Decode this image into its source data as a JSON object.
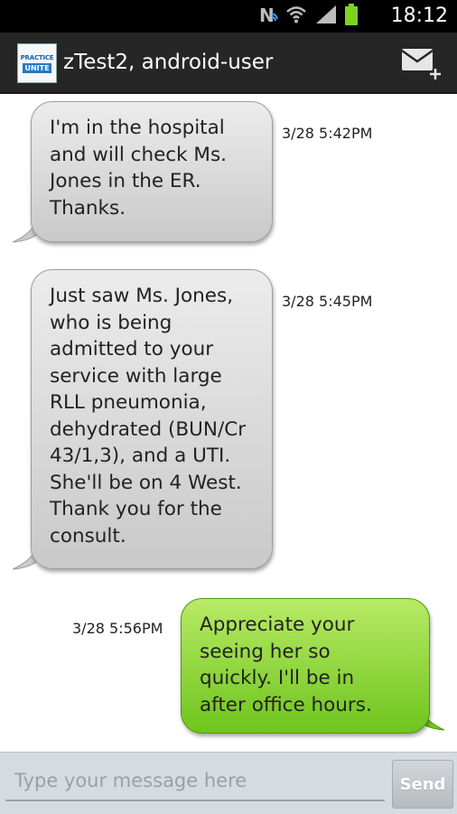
{
  "status_bar": {
    "time": "18:12",
    "icons": [
      "nfc-icon",
      "wifi-icon",
      "signal-icon",
      "battery-icon"
    ]
  },
  "header": {
    "logo_line1": "PRACTICE",
    "logo_line2": "UNITE",
    "title": "zTest2, android-user",
    "compose_icon": "compose-message-icon"
  },
  "messages": [
    {
      "direction": "incoming",
      "text": "I'm in the hospital\nand will check Ms.\nJones in the ER.\nThanks.",
      "timestamp": "3/28 5:42PM"
    },
    {
      "direction": "incoming",
      "text": "Just saw Ms. Jones,\nwho is being\nadmitted to your\nservice with large\nRLL pneumonia,\ndehydrated (BUN/Cr\n43/1,3), and a UTI.\nShe'll be on 4 West.\nThank you for the\nconsult.",
      "timestamp": "3/28 5:45PM"
    },
    {
      "direction": "outgoing",
      "text": "Appreciate your\nseeing her so\nquickly. I'll be in\nafter office hours.",
      "timestamp": "3/28 5:56PM"
    }
  ],
  "composer": {
    "placeholder": "Type your message here",
    "value": "",
    "send_label": "Send"
  },
  "colors": {
    "incoming_bubble": "#d9d9d9",
    "outgoing_bubble": "#8bd432",
    "header_bg": "#262626",
    "status_bg": "#000000"
  }
}
